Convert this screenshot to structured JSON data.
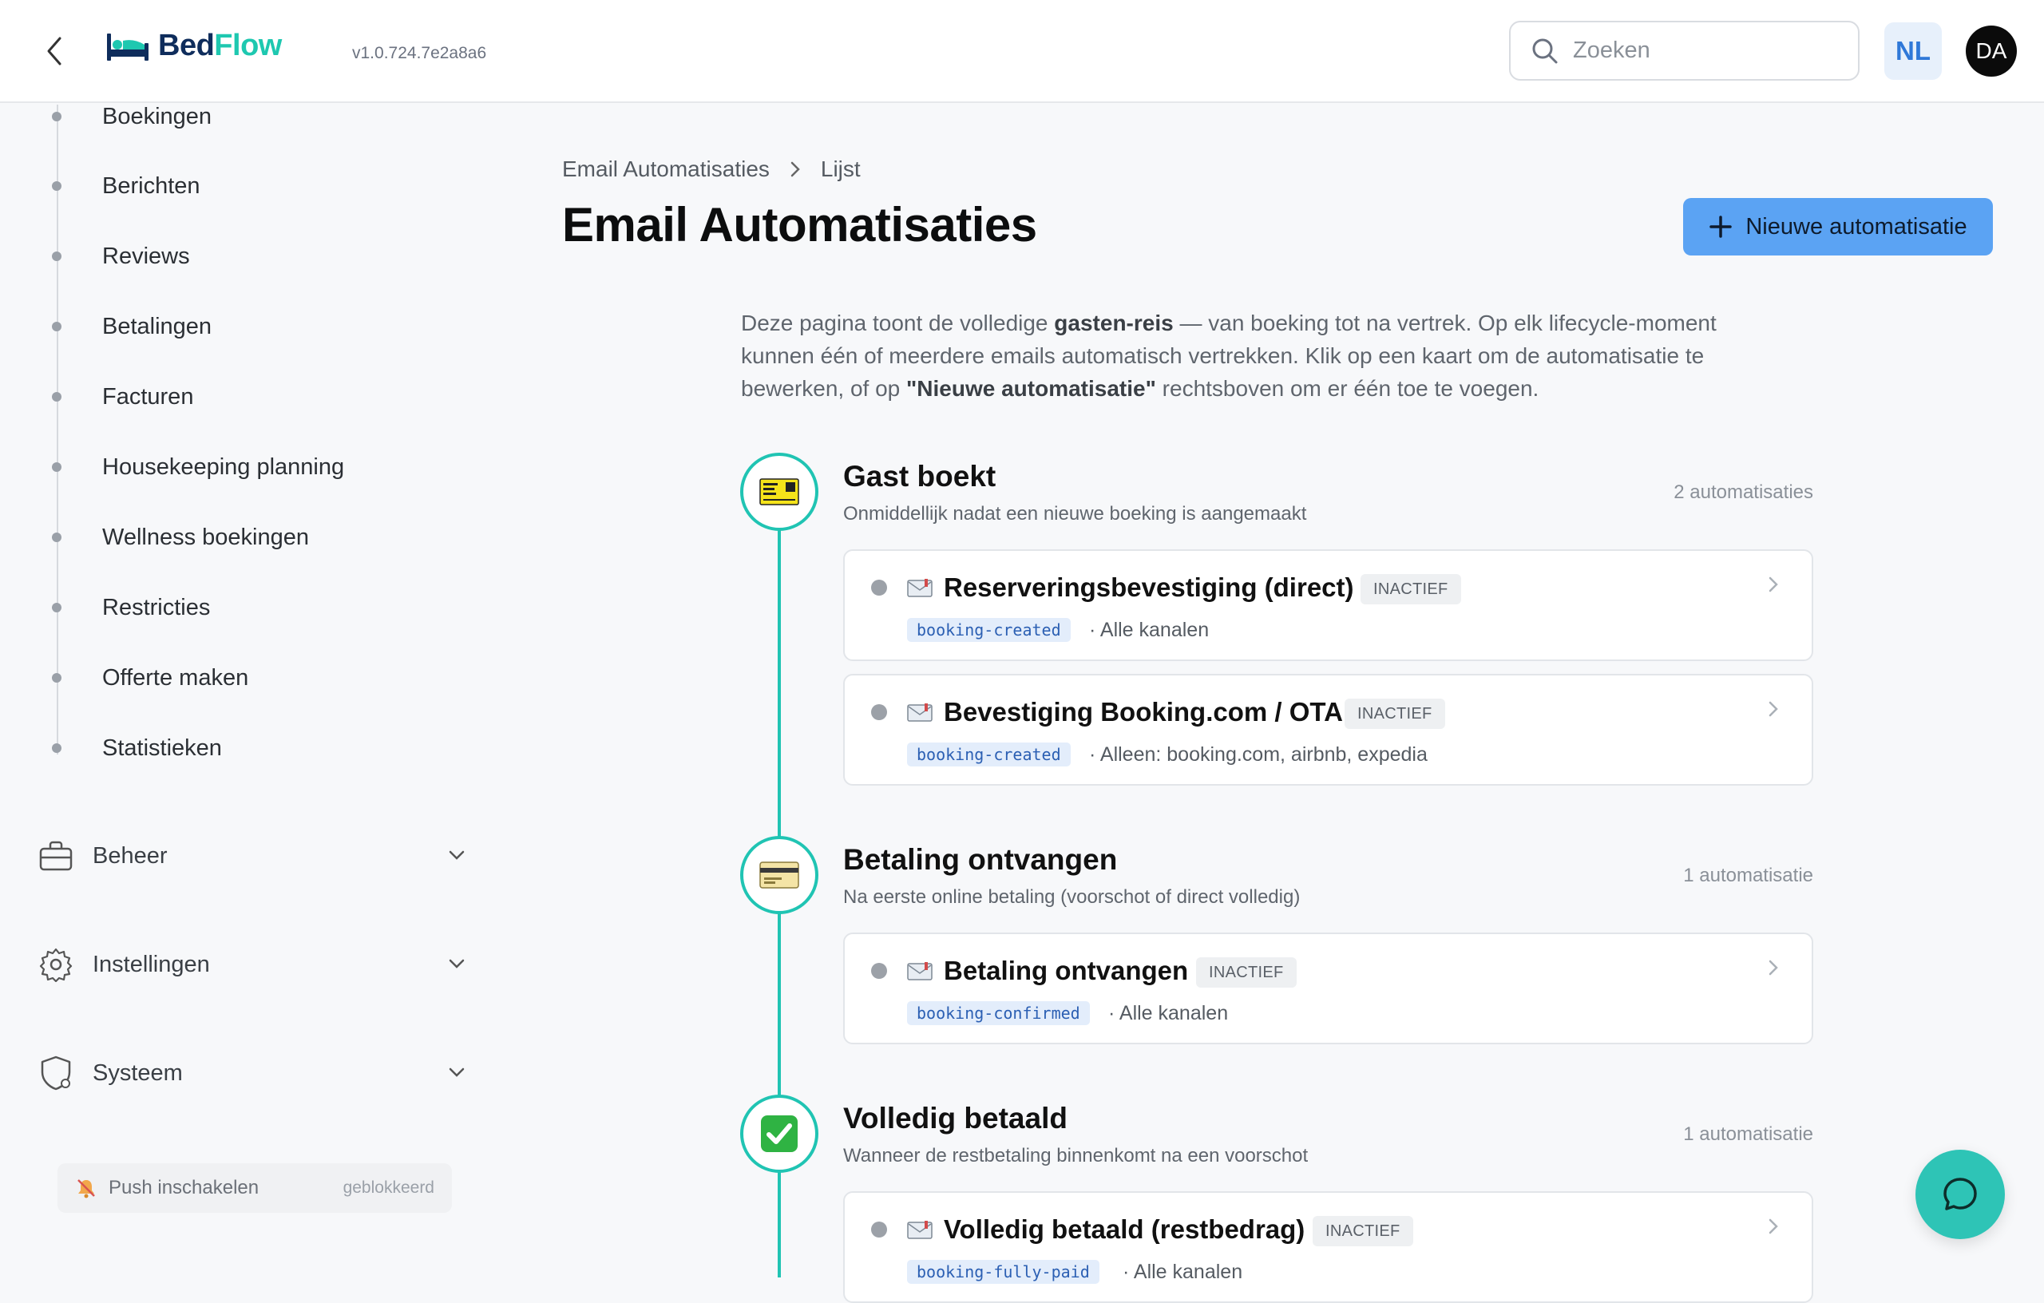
{
  "header": {
    "logo_bed": "Bed",
    "logo_flow": "Flow",
    "version": "v1.0.724.7e2a8a6",
    "search_placeholder": "Zoeken",
    "lang": "NL",
    "avatar_initials": "DA"
  },
  "sidebar": {
    "items": [
      {
        "label": "Boekingen"
      },
      {
        "label": "Berichten"
      },
      {
        "label": "Reviews"
      },
      {
        "label": "Betalingen"
      },
      {
        "label": "Facturen"
      },
      {
        "label": "Housekeeping planning"
      },
      {
        "label": "Wellness boekingen"
      },
      {
        "label": "Restricties"
      },
      {
        "label": "Offerte maken"
      },
      {
        "label": "Statistieken"
      }
    ],
    "groups": [
      {
        "label": "Beheer",
        "icon": "briefcase-icon"
      },
      {
        "label": "Instellingen",
        "icon": "gear-icon"
      },
      {
        "label": "Systeem",
        "icon": "shield-icon"
      }
    ],
    "push": {
      "label": "Push inschakelen",
      "state": "geblokkeerd"
    }
  },
  "main": {
    "breadcrumb": [
      "Email Automatisaties",
      "Lijst"
    ],
    "title": "Email Automatisaties",
    "new_button": "Nieuwe automatisatie",
    "intro": {
      "p1": "Deze pagina toont de volledige ",
      "b1": "gasten-reis",
      "p2": " — van boeking tot na vertrek. Op elk lifecycle-moment kunnen één of meerdere emails automatisch vertrekken. Klik op een kaart om de automatisatie te bewerken, of op ",
      "b2": "\"Nieuwe automatisatie\"",
      "p3": " rechtsboven om er één toe te voegen."
    },
    "stages": [
      {
        "icon": "ticket-icon",
        "title": "Gast boekt",
        "subtitle": "Onmiddellijk nadat een nieuwe boeking is aangemaakt",
        "count": "2 automatisaties",
        "cards": [
          {
            "title": "Reserveringsbevestiging (direct)",
            "status": "INACTIEF",
            "tag": "booking-created",
            "channel": "· Alle kanalen"
          },
          {
            "title": "Bevestiging Booking.com / OTA",
            "status": "INACTIEF",
            "tag": "booking-created",
            "channel": "· Alleen: booking.com, airbnb, expedia"
          }
        ]
      },
      {
        "icon": "credit-card-icon",
        "title": "Betaling ontvangen",
        "subtitle": "Na eerste online betaling (voorschot of direct volledig)",
        "count": "1 automatisatie",
        "cards": [
          {
            "title": "Betaling ontvangen",
            "status": "INACTIEF",
            "tag": "booking-confirmed",
            "channel": "· Alle kanalen"
          }
        ]
      },
      {
        "icon": "check-mark-icon",
        "title": "Volledig betaald",
        "subtitle": "Wanneer de restbetaling binnenkomt na een voorschot",
        "count": "1 automatisatie",
        "cards": [
          {
            "title": "Volledig betaald (restbedrag)",
            "status": "INACTIEF",
            "tag": "booking-fully-paid",
            "channel": "· Alle kanalen"
          }
        ]
      }
    ]
  },
  "colors": {
    "accent_teal": "#20c4b3",
    "primary_button": "#5ba3f3",
    "logo_navy": "#0f2d5c",
    "tag_bg": "#e3edfb"
  }
}
